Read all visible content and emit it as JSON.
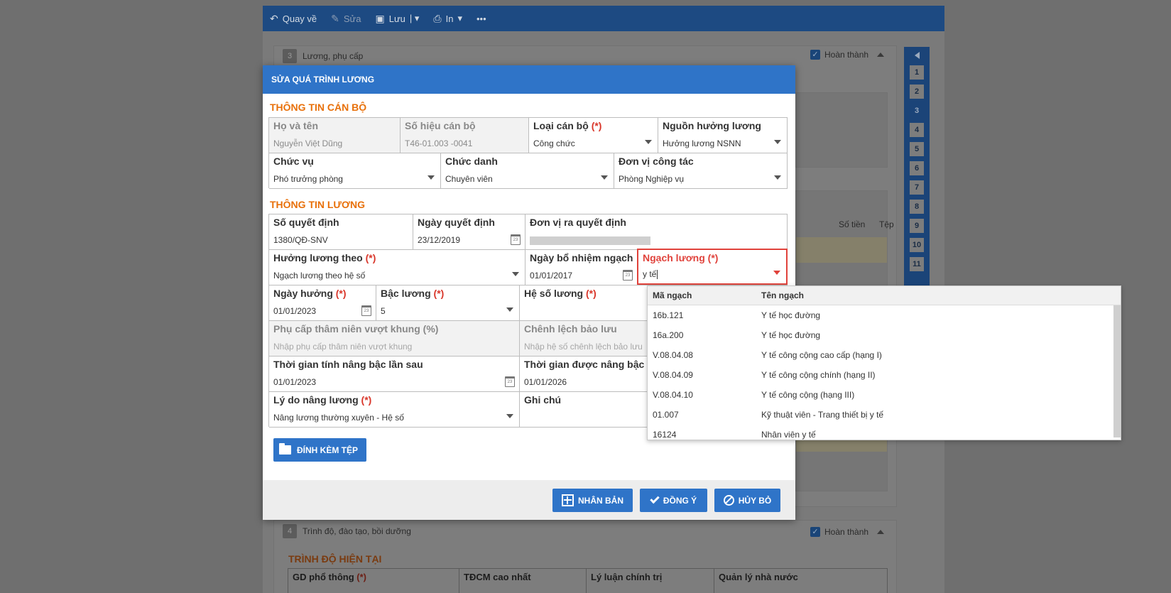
{
  "toolbar": {
    "back": "Quay về",
    "edit": "Sửa",
    "save": "Lưu",
    "print": "In",
    "more": "•••"
  },
  "background": {
    "section3_num": "3",
    "section3_title": "Lương, phụ cấp",
    "done_label": "Hoàn thành",
    "col_amount": "Số tiền",
    "col_file": "Tệp",
    "section4_num": "4",
    "section4_title": "Trình độ, đào tạo, bồi dưỡng",
    "current_level_title": "TRÌNH ĐỘ HIỆN TẠI",
    "grid_cols": [
      "GD phổ thông",
      "TĐCM cao nhất",
      "Lý luận chính trị",
      "Quản lý nhà nước"
    ],
    "required_mark": "(*)",
    "side_nav": [
      "1",
      "2",
      "3",
      "4",
      "5",
      "6",
      "7",
      "8",
      "9",
      "10",
      "11"
    ]
  },
  "modal": {
    "title": "SỬA QUÁ TRÌNH LƯƠNG",
    "staff_section": "THÔNG TIN CÁN BỘ",
    "salary_section": "THÔNG TIN LƯƠNG",
    "required_mark": "(*)",
    "fields": {
      "ho_ten": {
        "label": "Họ và tên",
        "value": "Nguyễn Việt Dũng"
      },
      "so_hieu": {
        "label": "Số hiệu cán bộ",
        "value": "T46-01.003 -0041"
      },
      "loai_can_bo": {
        "label": "Loại cán bộ",
        "value": "Công chức"
      },
      "nguon_luong": {
        "label": "Nguồn hưởng lương",
        "value": "Hưởng lương NSNN"
      },
      "chuc_vu": {
        "label": "Chức vụ",
        "value": "Phó trưởng phòng"
      },
      "chuc_danh": {
        "label": "Chức danh",
        "value": "Chuyên viên"
      },
      "don_vi": {
        "label": "Đơn vị công tác",
        "value": "Phòng Nghiệp vụ"
      },
      "so_qd": {
        "label": "Số quyết định",
        "value": "1380/QĐ-SNV"
      },
      "ngay_qd": {
        "label": "Ngày quyết định",
        "value": "23/12/2019"
      },
      "don_vi_qd": {
        "label": "Đơn vị ra quyết định",
        "value": ""
      },
      "huong_luong_theo": {
        "label": "Hưởng lương theo",
        "value": "Ngạch lương theo hệ số"
      },
      "ngay_bo_nhiem": {
        "label": "Ngày bổ nhiệm ngạch",
        "value": "01/01/2017"
      },
      "ngach_luong": {
        "label": "Ngạch lương",
        "value": "y tế"
      },
      "ngay_huong": {
        "label": "Ngày hưởng",
        "value": "01/01/2023"
      },
      "bac_luong": {
        "label": "Bậc lương",
        "value": "5"
      },
      "he_so": {
        "label": "Hệ số lương",
        "value": ""
      },
      "phu_cap": {
        "label": "Phụ cấp thâm niên vượt khung (%)",
        "placeholder": "Nhập phụ cấp thâm niên vượt khung"
      },
      "chenh_lech": {
        "label": "Chênh lệch bảo lưu",
        "placeholder": "Nhập hệ số chênh lệch bảo lưu"
      },
      "tg_nang_bac": {
        "label": "Thời gian tính nâng bậc lần sau",
        "value": "01/01/2023"
      },
      "tg_duoc_nang": {
        "label": "Thời gian được nâng bậc",
        "value": "01/01/2026"
      },
      "ly_do": {
        "label": "Lý do nâng lương",
        "value": "Nâng lương thường xuyên - Hệ số"
      },
      "ghi_chu": {
        "label": "Ghi chú",
        "value": ""
      }
    },
    "attach_label": "ĐÍNH KÈM TỆP",
    "btn_clone": "NHÂN BẢN",
    "btn_ok": "ĐỒNG Ý",
    "btn_cancel": "HỦY BỎ"
  },
  "dropdown": {
    "col_code": "Mã ngạch",
    "col_name": "Tên ngạch",
    "rows": [
      {
        "code": "16b.121",
        "name": "Y tế học đường"
      },
      {
        "code": "16a.200",
        "name": "Y tế học đường"
      },
      {
        "code": "V.08.04.08",
        "name": "Y tế công cộng cao cấp (hạng I)"
      },
      {
        "code": "V.08.04.09",
        "name": "Y tế công cộng chính (hạng II)"
      },
      {
        "code": "V.08.04.10",
        "name": "Y tế công cộng (hạng III)"
      },
      {
        "code": "01.007",
        "name": "Kỹ thuật viên - Trang thiết bị y tế"
      },
      {
        "code": "16124",
        "name": "Nhân viên y tế"
      }
    ]
  },
  "colors": {
    "primary": "#2f74c8",
    "section_title": "#e8700a",
    "required": "#d9362a",
    "highlight_border": "#e0423b"
  }
}
